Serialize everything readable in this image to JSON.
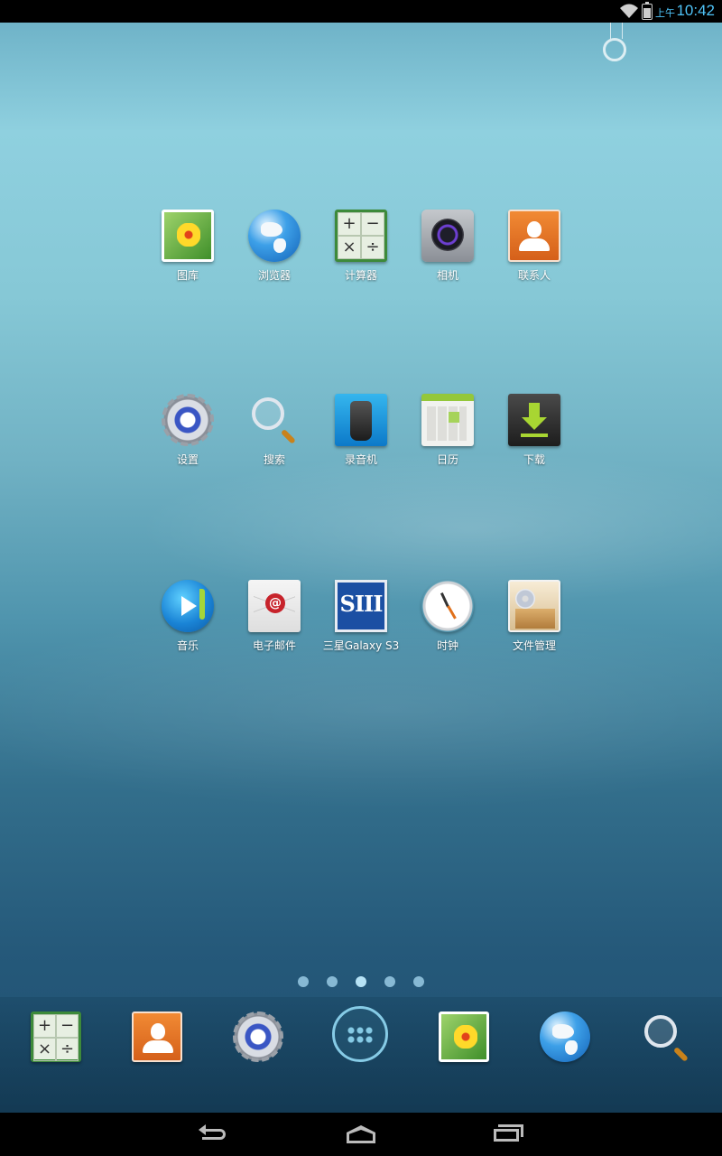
{
  "status_bar": {
    "time": "10:42",
    "ampm": "上午",
    "icons": [
      "wifi-icon",
      "battery-charging-icon"
    ]
  },
  "home": {
    "rows": [
      [
        {
          "label": "图库",
          "icon": "gallery-icon"
        },
        {
          "label": "浏览器",
          "icon": "browser-globe-icon"
        },
        {
          "label": "计算器",
          "icon": "calculator-icon"
        },
        {
          "label": "相机",
          "icon": "camera-icon"
        },
        {
          "label": "联系人",
          "icon": "contacts-icon"
        }
      ],
      [
        {
          "label": "设置",
          "icon": "settings-gear-icon"
        },
        {
          "label": "搜索",
          "icon": "search-magnifier-icon"
        },
        {
          "label": "录音机",
          "icon": "voice-recorder-icon"
        },
        {
          "label": "日历",
          "icon": "calendar-icon"
        },
        {
          "label": "下载",
          "icon": "download-icon"
        }
      ],
      [
        {
          "label": "音乐",
          "icon": "music-player-icon"
        },
        {
          "label": "电子邮件",
          "icon": "email-icon"
        },
        {
          "label": "三星Galaxy S3",
          "icon": "galaxy-s3-icon",
          "icon_text": "SIII"
        },
        {
          "label": "时钟",
          "icon": "clock-icon"
        },
        {
          "label": "文件管理",
          "icon": "file-manager-icon"
        }
      ]
    ],
    "calculator_symbols": [
      "+",
      "−",
      "×",
      "÷"
    ]
  },
  "page_indicator": {
    "count": 5,
    "active_index": 2
  },
  "dock": {
    "items": [
      "calculator-icon",
      "contacts-icon",
      "settings-gear-icon",
      "apps-drawer-icon",
      "gallery-icon",
      "browser-globe-icon",
      "search-magnifier-icon"
    ]
  },
  "nav_bar": {
    "buttons": [
      "back-icon",
      "home-icon",
      "recent-apps-icon"
    ]
  }
}
